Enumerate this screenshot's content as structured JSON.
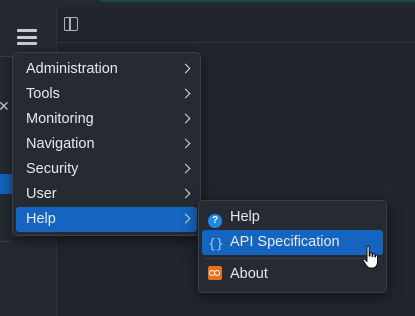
{
  "menu": {
    "items": [
      {
        "label": "Administration"
      },
      {
        "label": "Tools"
      },
      {
        "label": "Monitoring"
      },
      {
        "label": "Navigation"
      },
      {
        "label": "Security"
      },
      {
        "label": "User"
      },
      {
        "label": "Help"
      }
    ],
    "active_item": "Help"
  },
  "help_submenu": {
    "items": [
      {
        "label": "Help",
        "icon": "help-circle-icon"
      },
      {
        "label": "API Specification",
        "icon": "curly-braces-icon"
      },
      {
        "label": "About",
        "icon": "infinity-icon"
      }
    ],
    "hovered_item": "API Specification"
  },
  "icons": {
    "hamburger": "menu-icon",
    "panel_toggle": "sidebar-toggle-icon",
    "cursor": "hand-pointer-cursor"
  },
  "colors": {
    "accent": "#1565c0",
    "about_icon": "#e8701a",
    "help_icon": "#1e88e5"
  }
}
